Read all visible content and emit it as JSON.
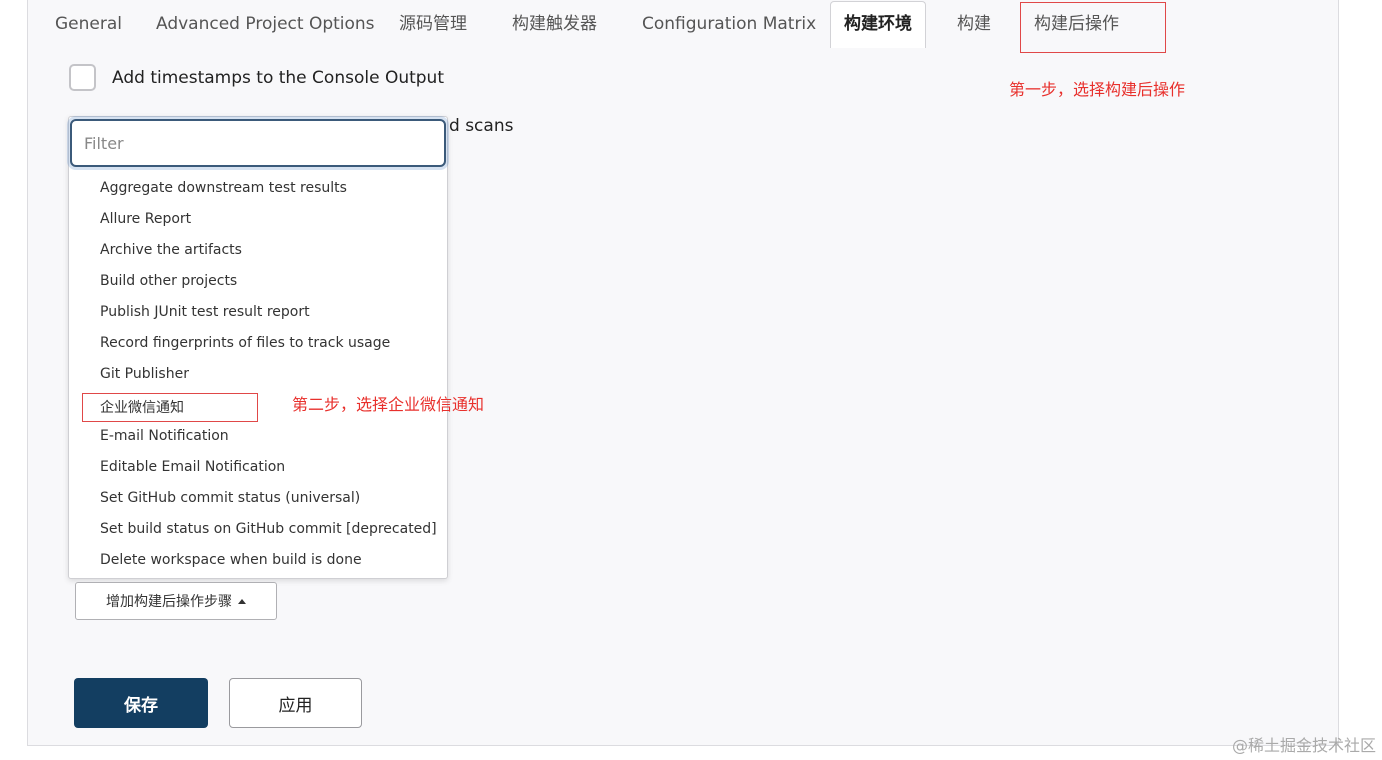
{
  "tabs": [
    {
      "label": "General"
    },
    {
      "label": "Advanced Project Options"
    },
    {
      "label": "源码管理"
    },
    {
      "label": "构建触发器"
    },
    {
      "label": "Configuration Matrix"
    },
    {
      "label": "构建环境",
      "active": true
    },
    {
      "label": "构建"
    },
    {
      "label": "构建后操作"
    }
  ],
  "annotations": {
    "step1": "第一步，选择构建后操作",
    "step2": "第二步，选择企业微信通知",
    "color": "#e8302c"
  },
  "options": {
    "timestamps_label": "Add timestamps to the Console Output",
    "partial_label_tail": "d scans"
  },
  "filter": {
    "placeholder": "Filter",
    "value": ""
  },
  "menu_items": [
    "Aggregate downstream test results",
    "Allure Report",
    "Archive the artifacts",
    "Build other projects",
    "Publish JUnit test result report",
    "Record fingerprints of files to track usage",
    "Git Publisher",
    "企业微信通知",
    "E-mail Notification",
    "Editable Email Notification",
    "Set GitHub commit status (universal)",
    "Set build status on GitHub commit [deprecated]",
    "Delete workspace when build is done"
  ],
  "add_step_button": "增加构建后操作步骤",
  "footer": {
    "save": "保存",
    "apply": "应用",
    "save_color": "#133e61"
  },
  "watermark": "@稀土掘金技术社区"
}
